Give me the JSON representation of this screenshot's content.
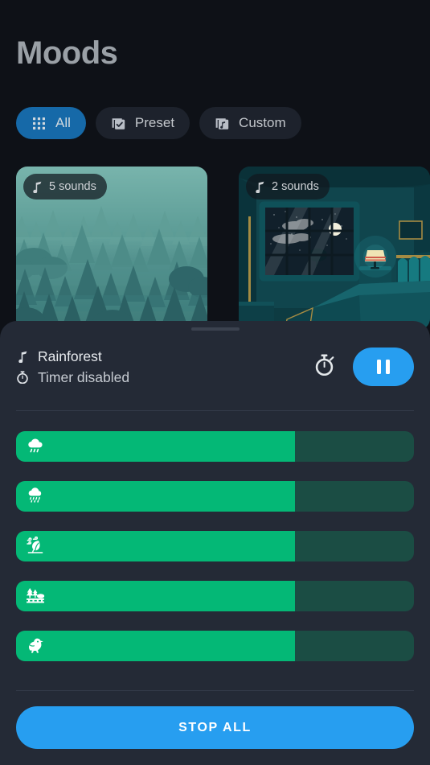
{
  "header": {
    "title": "Moods"
  },
  "filters": [
    {
      "id": "all",
      "label": "All",
      "icon": "grid-icon",
      "active": true
    },
    {
      "id": "preset",
      "label": "Preset",
      "icon": "checkbox-copy-icon",
      "active": false
    },
    {
      "id": "custom",
      "label": "Custom",
      "icon": "music-library-icon",
      "active": false
    }
  ],
  "cards": [
    {
      "id": "rainforest",
      "badge": "5 sounds",
      "icon": "music-note-icon",
      "scene": "forest"
    },
    {
      "id": "bedroom",
      "badge": "2 sounds",
      "icon": "music-note-icon",
      "scene": "bedroom"
    }
  ],
  "sheet": {
    "now_playing": {
      "title": "Rainforest",
      "title_icon": "music-note-icon",
      "timer_text": "Timer disabled",
      "timer_icon": "stopwatch-icon"
    },
    "timer_button": {
      "name": "timer-button",
      "icon": "stopwatch-icon"
    },
    "play_button": {
      "name": "pause-button",
      "icon": "pause-icon",
      "state": "playing"
    },
    "sliders": [
      {
        "id": "rain-heavy",
        "icon": "cloud-rain-icon",
        "value": 70
      },
      {
        "id": "rain-light",
        "icon": "cloud-drizzle-icon",
        "value": 70
      },
      {
        "id": "wind",
        "icon": "wind-storm-icon",
        "value": 70
      },
      {
        "id": "forest-park",
        "icon": "park-trees-icon",
        "value": 70
      },
      {
        "id": "birds",
        "icon": "bird-icon",
        "value": 70
      }
    ],
    "stop_all_label": "STOP ALL"
  },
  "colors": {
    "background": "#0e1117",
    "sheet": "#242a36",
    "accent_blue": "#279ef0",
    "chip_active": "#1669a8",
    "slider_fill": "#04b876",
    "slider_track": "#1b4d44",
    "title_text": "#9aa0a6"
  }
}
